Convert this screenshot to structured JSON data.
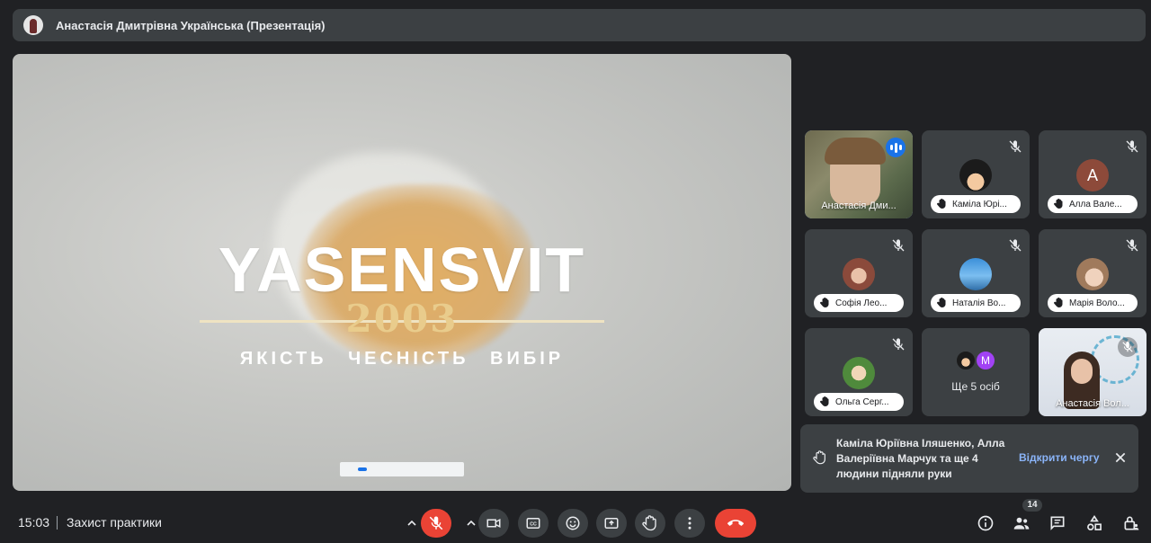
{
  "topbar": {
    "title": "Анастасія Дмитрівна Українська (Презентація)"
  },
  "presentation": {
    "brand": "YASENSVIT",
    "year": "2003",
    "tagline": "ЯКІСТЬ ЧЕСНІСТЬ ВИБІР"
  },
  "tiles": [
    {
      "name": "Анастасія Дми...",
      "speaking": true
    },
    {
      "name": "Каміла Юрі...",
      "hand_raised": true,
      "muted": true
    },
    {
      "name": "Алла Вале...",
      "avatar_letter": "A",
      "hand_raised": true,
      "muted": true
    },
    {
      "name": "Софія Лео...",
      "hand_raised": true,
      "muted": true
    },
    {
      "name": "Наталія Во...",
      "hand_raised": true,
      "muted": true
    },
    {
      "name": "Марія Воло...",
      "hand_raised": true,
      "muted": true
    },
    {
      "name": "Ольга Серг...",
      "hand_raised": true,
      "muted": true
    },
    {
      "name": "Ще 5 осіб",
      "avatar_letter": "M"
    },
    {
      "name": "Анастасія Вол...",
      "muted": true
    }
  ],
  "notification": {
    "message": "Каміла Юріївна Іляшенко, Алла Валеріївна Марчук та ще 4 людини підняли руки",
    "action": "Відкрити чергу"
  },
  "bottom": {
    "time": "15:03",
    "meeting_title": "Захист практики",
    "participant_count": "14"
  },
  "colors": {
    "background": "#202124",
    "surface": "#3c4043",
    "accent": "#8ab4f8",
    "end_call": "#ea4335",
    "mic_off": "#ea4335"
  }
}
